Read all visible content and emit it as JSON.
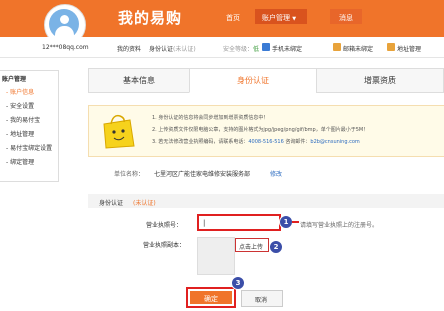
{
  "header": {
    "brand": "我的易购",
    "nav": {
      "home": "首页",
      "account": "账户管理",
      "account_arrow": "▼",
      "messages": "消息"
    }
  },
  "user_strip": {
    "username": "12***08qq.com",
    "my_profile": "我的资料",
    "id_verify": "身份认证",
    "id_status": "(未认证)",
    "security_label": "安全等级：",
    "security_level": "低",
    "phone": "手机未绑定",
    "email": "邮箱未绑定",
    "address": "地址管理"
  },
  "sidebar": {
    "title": "账户管理",
    "items": [
      {
        "label": "- 账户信息"
      },
      {
        "label": "- 安全设置"
      },
      {
        "label": "- 我的易付宝"
      },
      {
        "label": "- 地址管理"
      },
      {
        "label": "- 易付宝绑定设置"
      },
      {
        "label": "- 绑定管理"
      }
    ]
  },
  "tabs": [
    {
      "label": "基本信息"
    },
    {
      "label": "身份认证"
    },
    {
      "label": "增票资质"
    }
  ],
  "notice": {
    "line1": "1. 身份认证的信息将会同步增加到增票资质信息中！",
    "line2": "2. 上传资质文件仅限电脑公章，支持的图片格式为jpg/jpeg/png/gif/bmp，单个图片最小于5M！",
    "line3_prefix": "3. 若无法修改营业执照编码，请联系电话：",
    "phone": "4008-516-516",
    "email_label": "咨询邮件：",
    "email": "b2b@cnsuning.com"
  },
  "unit": {
    "label": "单位名称：",
    "value": "七里河区广能佳家电维修安装服务部",
    "edit": "修改"
  },
  "section": {
    "title": "身份认证",
    "status": "(未认证)"
  },
  "form": {
    "license_label": "营业执照号：",
    "license_value": "|",
    "license_hint": "请填写营业执照上的注册号。",
    "copy_label": "营业执照副本：",
    "upload": "点击上传",
    "confirm": "确定",
    "cancel": "取消"
  },
  "steps": [
    "1",
    "2",
    "3"
  ],
  "colors": {
    "brand": "#f0742a",
    "highlight": "#e02020",
    "badge": "#3b4ea8"
  }
}
